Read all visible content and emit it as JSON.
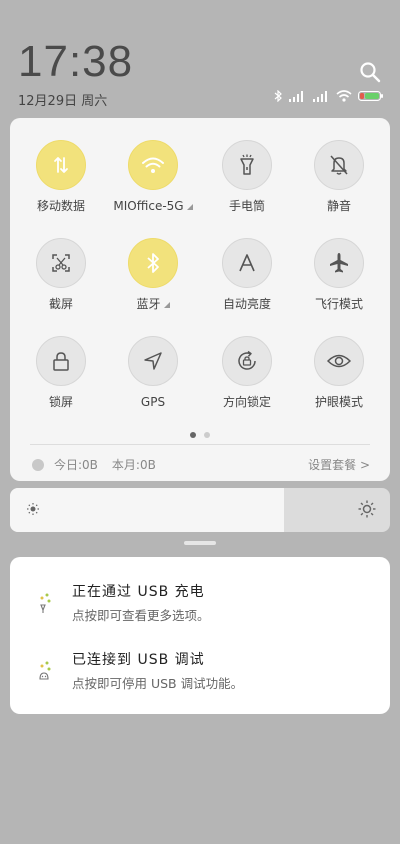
{
  "header": {
    "time": "17:38",
    "date": "12月29日 周六",
    "battery_color": "#6ad06a"
  },
  "toggles": [
    {
      "label": "移动数据",
      "icon": "data-arrows-icon",
      "on": true
    },
    {
      "label": "MIOffice-5G",
      "icon": "wifi-icon",
      "on": true
    },
    {
      "label": "手电筒",
      "icon": "flashlight-icon",
      "on": false
    },
    {
      "label": "静音",
      "icon": "mute-bell-icon",
      "on": false
    },
    {
      "label": "截屏",
      "icon": "screenshot-icon",
      "on": false
    },
    {
      "label": "蓝牙",
      "icon": "bluetooth-icon",
      "on": true
    },
    {
      "label": "自动亮度",
      "icon": "auto-brightness-icon",
      "on": false
    },
    {
      "label": "飞行模式",
      "icon": "airplane-icon",
      "on": false
    },
    {
      "label": "锁屏",
      "icon": "lock-icon",
      "on": false
    },
    {
      "label": "GPS",
      "icon": "gps-icon",
      "on": false
    },
    {
      "label": "方向锁定",
      "icon": "rotation-lock-icon",
      "on": false
    },
    {
      "label": "护眼模式",
      "icon": "eye-icon",
      "on": false
    }
  ],
  "usage": {
    "today": "今日:0B",
    "month": "本月:0B",
    "plan_link": "设置套餐 >"
  },
  "brightness": {
    "level": 0.72
  },
  "notifications": [
    {
      "title": "正在通过 USB 充电",
      "subtitle": "点按即可查看更多选项。"
    },
    {
      "title": "已连接到 USB 调试",
      "subtitle": "点按即可停用 USB 调试功能。"
    }
  ],
  "colors": {
    "toggle_on": "#f2e27c",
    "toggle_off": "#e6e6e6"
  }
}
